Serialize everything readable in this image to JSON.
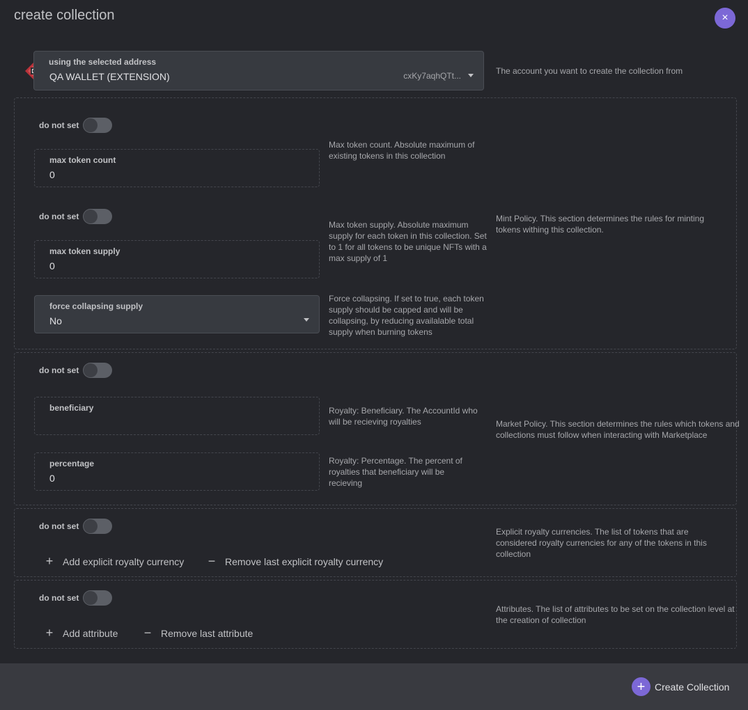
{
  "header": {
    "title": "create collection",
    "close_icon": "×"
  },
  "account": {
    "label": "using the selected address",
    "value": "QA WALLET (EXTENSION)",
    "address": "cxKy7aqhQTt...",
    "description": "The account you want to create the collection from"
  },
  "mint_policy": {
    "description": "Mint Policy. This section determines the rules for minting tokens withing this collection.",
    "max_token_count": {
      "toggle_label": "do not set",
      "toggle_on": false,
      "label": "max token count",
      "value": "0",
      "description": "Max token count. Absolute maximum of existing tokens in this collection"
    },
    "max_token_supply": {
      "toggle_label": "do not set",
      "toggle_on": false,
      "label": "max token supply",
      "value": "0",
      "description": "Max token supply. Absolute maximum supply for each token in this collection. Set to 1 for all tokens to be unique NFTs with a max supply of 1"
    },
    "force_collapsing": {
      "label": "force collapsing supply",
      "value": "No",
      "description": "Force collapsing. If set to true, each token supply should be capped and will be collapsing, by reducing availalable total supply when burning tokens"
    }
  },
  "market_policy": {
    "toggle_label": "do not set",
    "toggle_on": false,
    "description": "Market Policy. This section determines the rules which tokens and collections must follow when interacting with Marketplace",
    "beneficiary": {
      "label": "beneficiary",
      "value": "",
      "description": "Royalty: Beneficiary. The AccountId who will be recieving royalties"
    },
    "percentage": {
      "label": "percentage",
      "value": "0",
      "description": "Royalty: Percentage. The percent of royalties that beneficiary will be recieving"
    }
  },
  "royalty_currencies": {
    "toggle_label": "do not set",
    "toggle_on": false,
    "add_label": "Add explicit royalty currency",
    "remove_label": "Remove last explicit royalty currency",
    "description": "Explicit royalty currencies. The list of tokens that are considered royalty currencies for any of the tokens in this collection"
  },
  "attributes": {
    "toggle_label": "do not set",
    "toggle_on": false,
    "add_label": "Add attribute",
    "remove_label": "Remove last attribute",
    "description": "Attributes. The list of attributes to be set on the collection level at the creation of collection"
  },
  "footer": {
    "create_label": "Create Collection"
  },
  "icons": {
    "plus": "+",
    "minus": "−"
  },
  "colors": {
    "accent": "#7c68d6",
    "background": "#25262b",
    "footer": "#393a40"
  }
}
